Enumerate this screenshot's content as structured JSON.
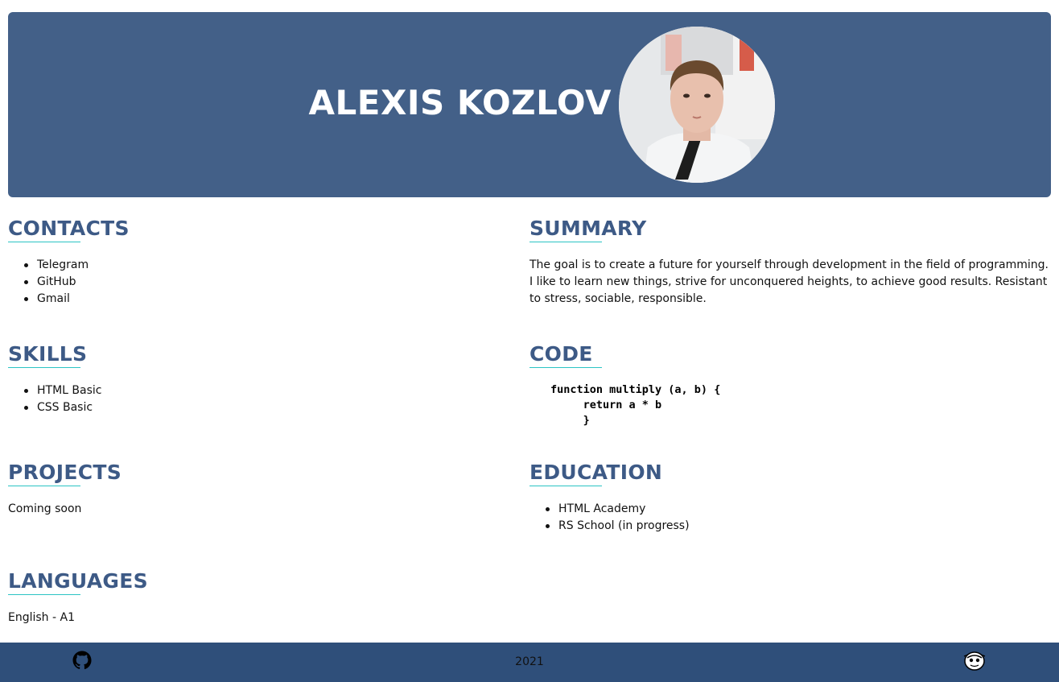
{
  "header": {
    "name": "ALEXIS KOZLOV"
  },
  "contacts": {
    "title": "CONTACTS",
    "items": [
      "Telegram",
      "GitHub",
      "Gmail"
    ]
  },
  "skills": {
    "title": "SKILLS",
    "items": [
      "HTML Basic",
      "CSS Basic"
    ]
  },
  "projects": {
    "title": "PROJECTS",
    "text": "Coming soon"
  },
  "languages": {
    "title": "LANGUAGES",
    "text": "English - A1"
  },
  "summary": {
    "title": "SUMMARY",
    "text": "The goal is to create a future for yourself through development in the field of programming. I like to learn new things, strive for unconquered heights, to achieve good results. Resistant to stress, sociable, responsible."
  },
  "code": {
    "title": "CODE",
    "lines": [
      "function multiply (a, b) {",
      "     return a * b",
      "     }"
    ]
  },
  "education": {
    "title": "EDUCATION",
    "items": [
      "HTML Academy",
      "RS School (in progress)"
    ]
  },
  "footer": {
    "year": "2021",
    "left_icon": "github-icon",
    "right_icon": "rs-school-icon"
  },
  "colors": {
    "header_bg": "#436088",
    "footer_bg": "#2f4f7a",
    "heading": "#3d5a86",
    "accent_underline": "#2bc4c4"
  }
}
